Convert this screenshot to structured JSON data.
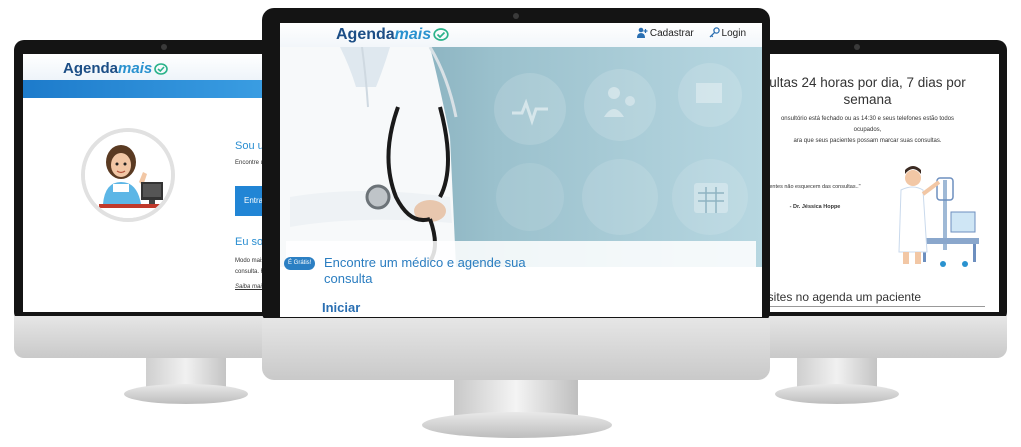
{
  "brand": {
    "name_main": "Agenda",
    "name_accent": "mais",
    "primary": "#1c4e86",
    "accent": "#2a92cf"
  },
  "left_screen": {
    "title1": "Sou um m",
    "text1": "Encontre um",
    "button_label": "Entrar a",
    "title2": "Eu sou m",
    "text2_line1": "Modo mais r",
    "text2_line2": "consulta. Re",
    "link_label": "Saiba mais"
  },
  "center_screen": {
    "nav": {
      "register_label": "Cadastrar",
      "login_label": "Login"
    },
    "badge": "É Grátis!",
    "headline": "Encontre um médico e agende sua consulta",
    "start_label": "Iniciar"
  },
  "right_screen": {
    "heading": "ultas 24 horas por dia, 7 dias por semana",
    "text_line1": "onsultório está fechado ou as 14:30 e seus telefones estão todos",
    "text_line2": "ocupados,",
    "text_line3": "ara que seus pacientes possam marcar suas consultas.",
    "quote": "entes não esquecem das consultas..\"",
    "author": "- Dr. Jéssica Hoppe",
    "bottom_text": "isites no agenda um paciente"
  }
}
